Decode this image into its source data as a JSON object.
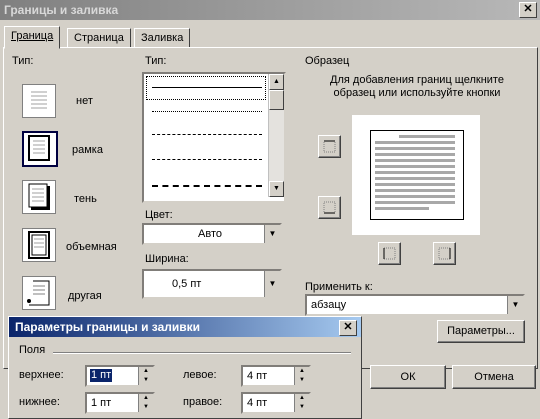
{
  "window": {
    "title": "Границы и заливка",
    "close": "✕"
  },
  "tabs": [
    {
      "label": "Граница"
    },
    {
      "label": "Страница"
    },
    {
      "label": "Заливка"
    }
  ],
  "type_section": {
    "label": "Тип:",
    "options": [
      {
        "label": "нет"
      },
      {
        "label": "рамка"
      },
      {
        "label": "тень"
      },
      {
        "label": "объемная"
      },
      {
        "label": "другая"
      }
    ]
  },
  "style_section": {
    "label": "Тип:",
    "color_label": "Цвет:",
    "color_value": "Авто",
    "width_label": "Ширина:",
    "width_value": "0,5 пт"
  },
  "preview": {
    "label": "Образец",
    "hint": "Для добавления границ щелкните образец или используйте кнопки"
  },
  "apply": {
    "label": "Применить к:",
    "value": "абзацу"
  },
  "buttons": {
    "options": "Параметры...",
    "ok": "ОК",
    "cancel": "Отмена"
  },
  "options_dialog": {
    "title": "Параметры границы и заливки",
    "close": "✕",
    "group": "Поля",
    "top_label": "верхнее:",
    "top_value": "1 пт",
    "left_label": "левое:",
    "left_value": "4 пт",
    "bottom_label": "нижнее:",
    "bottom_value": "1 пт",
    "right_label": "правое:",
    "right_value": "4 пт"
  }
}
